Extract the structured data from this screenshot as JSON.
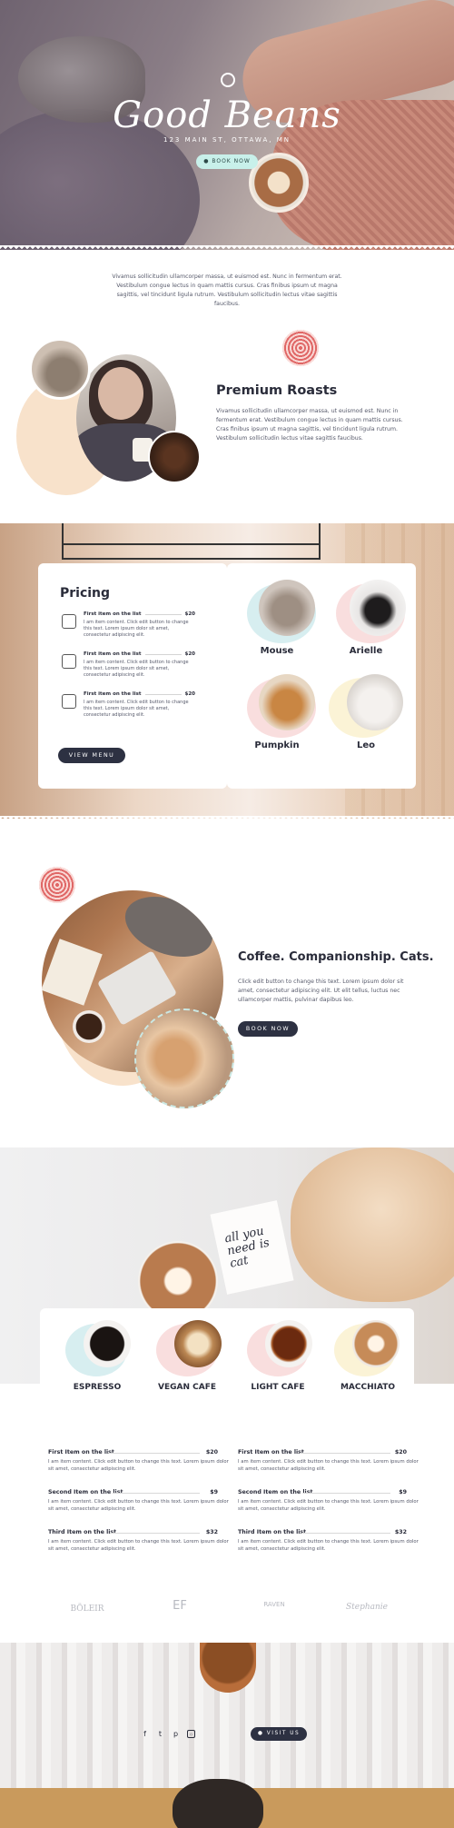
{
  "hero": {
    "logo": "Good Beans",
    "address": "123 MAIN ST, OTTAWA, MN",
    "book_now": "BOOK NOW"
  },
  "intro": "Vivamus sollicitudin ullamcorper massa, ut euismod est. Nunc in fermentum erat. Vestibulum congue lectus in quam mattis cursus. Cras finibus ipsum ut magna sagittis, vel tincidunt ligula rutrum. Vestibulum sollicitudin lectus vitae sagittis faucibus.",
  "roasts": {
    "title": "Premium Roasts",
    "text": "Vivamus sollicitudin ullamcorper massa, ut euismod est. Nunc in fermentum erat. Vestibulum congue lectus in quam mattis cursus. Cras finibus ipsum ut magna sagittis, vel tincidunt ligula rutrum. Vestibulum sollicitudin lectus vitae sagittis faucibus."
  },
  "pricing": {
    "title": "Pricing",
    "items": [
      {
        "name": "First item on the list",
        "price": "$20",
        "desc": "I am item content. Click edit button to change this text. Lorem ipsum dolor sit amet, consectetur adipiscing elit."
      },
      {
        "name": "First item on the list",
        "price": "$20",
        "desc": "I am item content. Click edit button to change this text. Lorem ipsum dolor sit amet, consectetur adipiscing elit."
      },
      {
        "name": "First item on the list",
        "price": "$20",
        "desc": "I am item content. Click edit button to change this text. Lorem ipsum dolor sit amet, consectetur adipiscing elit."
      }
    ],
    "view_menu": "VIEW MENU"
  },
  "cats": [
    {
      "name": "Mouse"
    },
    {
      "name": "Arielle"
    },
    {
      "name": "Pumpkin"
    },
    {
      "name": "Leo"
    }
  ],
  "companionship": {
    "title": "Coffee. Companionship. Cats.",
    "text": "Click edit button to change this text. Lorem ipsum dolor sit amet, consectetur adipiscing elit. Ut elit tellus, luctus nec ullamcorper mattis, pulvinar dapibus leo.",
    "book_now": "BOOK NOW"
  },
  "sign_text": "all you need is cat",
  "drinks": [
    {
      "name": "ESPRESSO"
    },
    {
      "name": "VEGAN CAFE"
    },
    {
      "name": "LIGHT CAFE"
    },
    {
      "name": "MACCHIATO"
    }
  ],
  "menu": {
    "left": [
      {
        "name": "First Item on the list",
        "price": "$20",
        "desc": "I am item content. Click edit button to change this text. Lorem ipsum dolor sit amet, consectetur adipiscing elit."
      },
      {
        "name": "Second Item on the list",
        "price": "$9",
        "desc": "I am item content. Click edit button to change this text. Lorem ipsum dolor sit amet, consectetur adipiscing elit."
      },
      {
        "name": "Third Item on the list",
        "price": "$32",
        "desc": "I am item content. Click edit button to change this text. Lorem ipsum dolor sit amet, consectetur adipiscing elit."
      }
    ],
    "right": [
      {
        "name": "First Item on the list",
        "price": "$20",
        "desc": "I am item content. Click edit button to change this text. Lorem ipsum dolor sit amet, consectetur adipiscing elit."
      },
      {
        "name": "Second Item on the list",
        "price": "$9",
        "desc": "I am item content. Click edit button to change this text. Lorem ipsum dolor sit amet, consectetur adipiscing elit."
      },
      {
        "name": "Third Item on the list",
        "price": "$32",
        "desc": "I am item content. Click edit button to change this text. Lorem ipsum dolor sit amet, consectetur adipiscing elit."
      }
    ]
  },
  "brands": [
    "BÖLEIR",
    "EF",
    "RAVEN",
    "Stephanie"
  ],
  "footer": {
    "visit_us": "VISIT US",
    "socials": [
      "facebook-icon",
      "twitter-icon",
      "foursquare-icon",
      "instagram-icon"
    ]
  },
  "colors": {
    "dark": "#2d3142",
    "mint": "#c8f0ea",
    "peach": "#f8e2cb",
    "swirl_red": "#e06766"
  }
}
